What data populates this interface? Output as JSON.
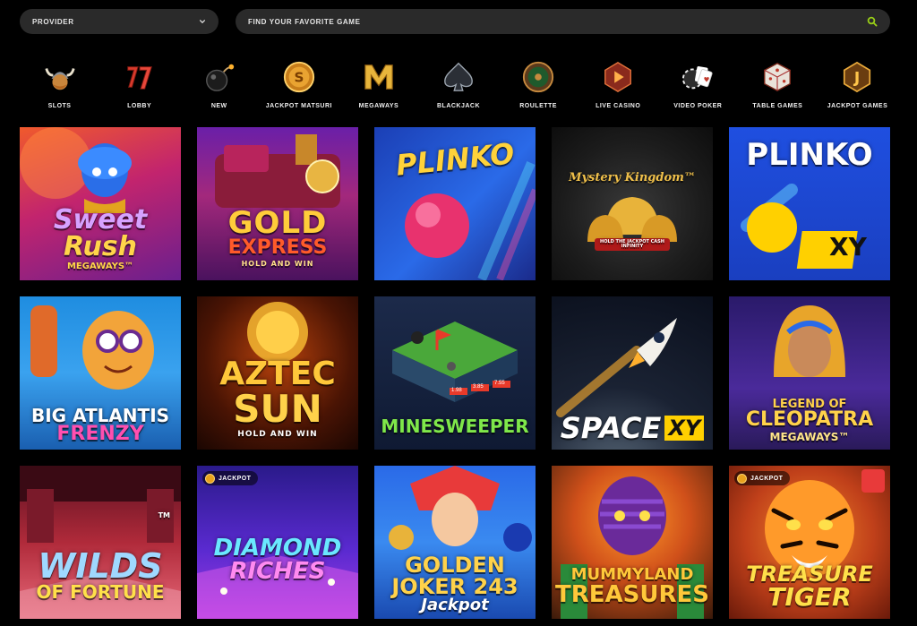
{
  "provider": {
    "label": "PROVIDER"
  },
  "search": {
    "placeholder": "FIND YOUR FAVORITE GAME"
  },
  "colors": {
    "accent": "#9ad017",
    "bar_bg": "#2a2a2a",
    "page_bg": "#000000"
  },
  "categories": [
    {
      "label": "SLOTS",
      "icon": "viking-helmet-icon"
    },
    {
      "label": "LOBBY",
      "icon": "lucky-seven-icon"
    },
    {
      "label": "NEW",
      "icon": "bomb-icon"
    },
    {
      "label": "JACKPOT MATSURI",
      "icon": "jackpot-coin-icon"
    },
    {
      "label": "MEGAWAYS",
      "icon": "megaways-m-icon"
    },
    {
      "label": "BLACKJACK",
      "icon": "spade-icon"
    },
    {
      "label": "ROULETTE",
      "icon": "roulette-wheel-icon"
    },
    {
      "label": "LIVE CASINO",
      "icon": "live-play-icon"
    },
    {
      "label": "VIDEO POKER",
      "icon": "poker-cards-icon"
    },
    {
      "label": "TABLE GAMES",
      "icon": "dice-icon"
    },
    {
      "label": "JACKPOT GAMES",
      "icon": "jackpot-j-icon"
    }
  ],
  "games": [
    {
      "t1": "Sweet",
      "t2": "Rush",
      "t3": "MEGAWAYS™"
    },
    {
      "t1": "GOLD",
      "t2": "EXPRESS",
      "t3": "HOLD AND WIN"
    },
    {
      "t1": "PLINKO"
    },
    {
      "t1": "Mystery Kingdom™",
      "t3": "HOLD THE JACKPOT CASH INFINITY"
    },
    {
      "t1": "PLINKO",
      "t2": "XY"
    },
    {
      "t1": "BIG ATLANTIS",
      "t2": "FRENZY"
    },
    {
      "t1": "AZTEC",
      "t2": "SUN",
      "t3": "HOLD AND WIN"
    },
    {
      "t1": "MINESWEEPER",
      "t2": "1.98",
      "t3": "3.85",
      "t4": "7.55"
    },
    {
      "t1": "SPACE",
      "t2": "XY"
    },
    {
      "t1": "LEGEND OF",
      "t2": "CLEOPATRA",
      "t3": "MEGAWAYS™"
    },
    {
      "t1": "WILDS",
      "t2": "OF FORTUNE",
      "t3": "TM"
    },
    {
      "jp": "JACKPOT",
      "t1": "DIAMOND",
      "t2": "RICHES"
    },
    {
      "t1": "GOLDEN",
      "t2": "JOKER 243",
      "t3": "Jackpot"
    },
    {
      "t1": "MUMMYLAND",
      "t2": "TREASURES"
    },
    {
      "jp": "JACKPOT",
      "t1": "TREASURE",
      "t2": "TIGER"
    }
  ]
}
